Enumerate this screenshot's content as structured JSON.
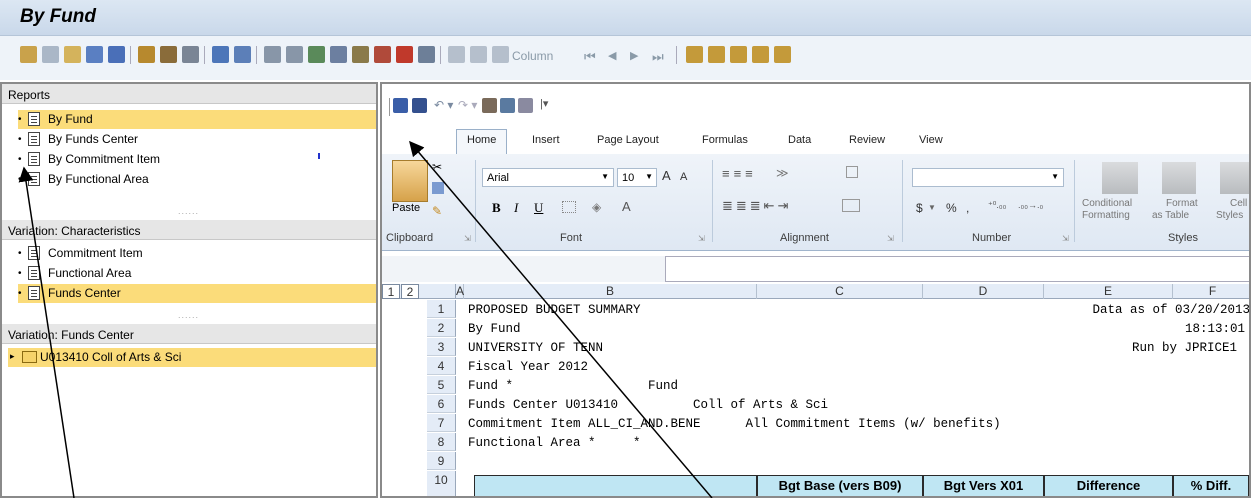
{
  "window": {
    "title": "By Fund"
  },
  "toolbar": {
    "column_label": "Column"
  },
  "left_pane": {
    "sections": [
      {
        "header": "Reports",
        "items": [
          "By Fund",
          "By Funds Center",
          "By Commitment Item",
          "By Functional Area"
        ],
        "selected": 0
      },
      {
        "header": "Variation: Characteristics",
        "items": [
          "Commitment Item",
          "Functional Area",
          "Funds Center"
        ],
        "selected": 2
      },
      {
        "header": "Variation: Funds Center",
        "items": [
          "U013410 Coll of Arts & Sci"
        ],
        "selected": 0
      }
    ]
  },
  "ribbon": {
    "tabs": [
      "Home",
      "Insert",
      "Page Layout",
      "Formulas",
      "Data",
      "Review",
      "View"
    ],
    "active_tab": "Home",
    "groups": {
      "clipboard": "Clipboard",
      "font": "Font",
      "alignment": "Alignment",
      "number": "Number",
      "styles": "Styles"
    },
    "font_name": "Arial",
    "font_size": "10",
    "paste": "Paste",
    "conditional": "Conditional",
    "formatting": "Formatting",
    "format": "Format",
    "as_table": "as Table",
    "cell": "Cell",
    "cell_styles": "Styles",
    "currency": "$",
    "percent": "%",
    "comma": ","
  },
  "sheet": {
    "outline_levels": [
      "1",
      "2"
    ],
    "columns": [
      "A",
      "B",
      "C",
      "D",
      "E",
      "F"
    ],
    "rows": [
      {
        "n": "1",
        "b": "PROPOSED BUDGET SUMMARY",
        "e": "Data as of 03/20/2013"
      },
      {
        "n": "2",
        "b": "By Fund",
        "e": "18:13:01"
      },
      {
        "n": "3",
        "b": "UNIVERSITY OF TENN",
        "e": "Run by JPRICE1"
      },
      {
        "n": "4",
        "b": "Fiscal Year 2012"
      },
      {
        "n": "5",
        "b": "Fund *                  Fund"
      },
      {
        "n": "6",
        "b": "Funds Center U013410          Coll of Arts & Sci"
      },
      {
        "n": "7",
        "b": "Commitment Item ALL_CI_AND.BENE      All Commitment Items (w/ benefits)"
      },
      {
        "n": "8",
        "b": "Functional Area *     *"
      },
      {
        "n": "9",
        "b": ""
      },
      {
        "n": "10",
        "b": ""
      }
    ],
    "header_row": [
      "Bgt Base (vers B09)",
      "Bgt Vers X01",
      "Difference",
      "% Diff."
    ]
  }
}
